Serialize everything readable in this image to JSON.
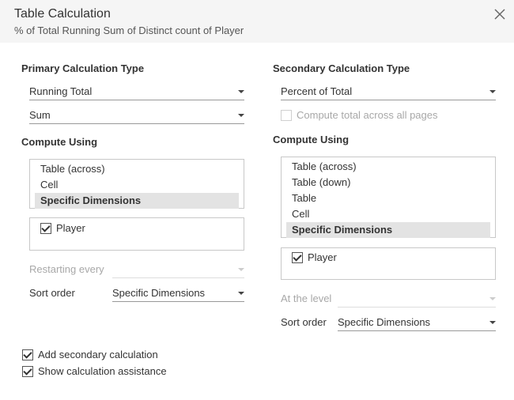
{
  "dialog": {
    "title": "Table Calculation",
    "subtitle": "% of Total Running Sum of Distinct count of Player"
  },
  "primary": {
    "heading": "Primary Calculation Type",
    "calc_type": "Running Total",
    "aggregation": "Sum",
    "compute_using_heading": "Compute Using",
    "compute_options": [
      "Table (across)",
      "Cell",
      "Specific Dimensions"
    ],
    "selected_option": "Specific Dimensions",
    "dimensions": [
      {
        "label": "Player",
        "checked": true
      }
    ],
    "restarting_every_label": "Restarting every",
    "restarting_every_value": "",
    "sort_order_label": "Sort order",
    "sort_order_value": "Specific Dimensions"
  },
  "secondary": {
    "heading": "Secondary Calculation Type",
    "calc_type": "Percent of Total",
    "compute_total_label": "Compute total across all pages",
    "compute_total_checked": false,
    "compute_using_heading": "Compute Using",
    "compute_options": [
      "Table (across)",
      "Table (down)",
      "Table",
      "Cell",
      "Specific Dimensions"
    ],
    "selected_option": "Specific Dimensions",
    "dimensions": [
      {
        "label": "Player",
        "checked": true
      }
    ],
    "at_the_level_label": "At the level",
    "at_the_level_value": "",
    "sort_order_label": "Sort order",
    "sort_order_value": "Specific Dimensions"
  },
  "footer": {
    "add_secondary_label": "Add secondary calculation",
    "add_secondary_checked": true,
    "show_assistance_label": "Show calculation assistance",
    "show_assistance_checked": true
  },
  "icons": {
    "close": "close-icon",
    "dropdown": "chevron-down-icon",
    "checkbox": "checkbox-icon"
  }
}
